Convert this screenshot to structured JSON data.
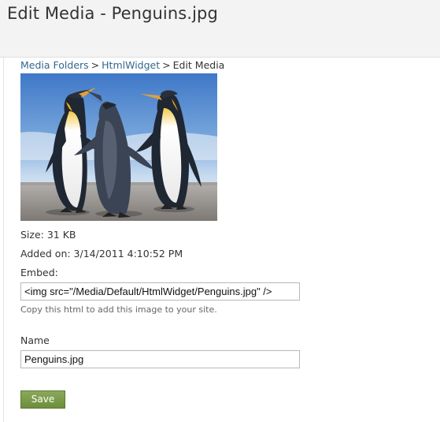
{
  "page": {
    "title": "Edit Media - Penguins.jpg"
  },
  "breadcrumb": {
    "items": [
      "Media Folders",
      "HtmlWidget",
      "Edit Media"
    ],
    "separator": ">"
  },
  "image": {
    "alt": "Penguins"
  },
  "details": {
    "size_label": "Size: 31 KB",
    "added_label": "Added on: 3/14/2011 4:10:52 PM",
    "embed_label": "Embed:",
    "embed_value": "<img src=\"/Media/Default/HtmlWidget/Penguins.jpg\"  />",
    "embed_hint": "Copy this html to add this image to your site."
  },
  "name_field": {
    "label": "Name",
    "value": "Penguins.jpg"
  },
  "actions": {
    "save_label": "Save"
  },
  "colors": {
    "link": "#33668f",
    "save_button": "#7a9b48",
    "header_bg": "#f3f3f3"
  }
}
